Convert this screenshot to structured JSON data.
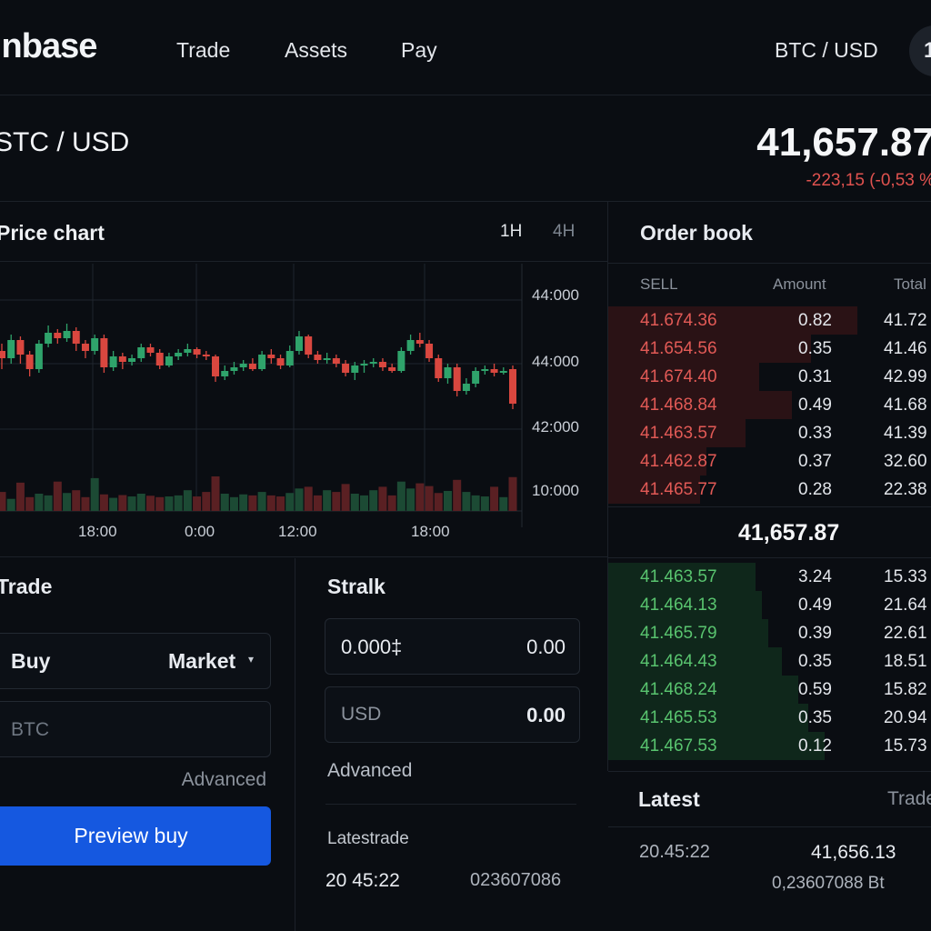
{
  "nav": {
    "logo": "inbase",
    "links": [
      "Trade",
      "Assets",
      "Pay"
    ],
    "pair": "BTC / USD",
    "avatar_initial": "1"
  },
  "ticker": {
    "pair": "STC / USD",
    "price": "41,657.87",
    "change": "-223,15 (-0,53 %"
  },
  "chart": {
    "title": "Price chart",
    "timeframes": [
      "1H",
      "4H"
    ],
    "y_labels": [
      "44:000",
      "44:000",
      "42:000",
      "10:000"
    ],
    "x_labels": [
      "18:00",
      "0:00",
      "12:00",
      "18:00"
    ]
  },
  "chart_data": {
    "type": "candlestick",
    "up_color": "#2fa36b",
    "down_color": "#d9473f",
    "note_candles": "open/close/high/low in price-axis units estimated from the printed tick labels",
    "candles": [
      {
        "o": 0.62,
        "c": 0.58,
        "h": 0.66,
        "l": 0.52
      },
      {
        "o": 0.58,
        "c": 0.68,
        "h": 0.71,
        "l": 0.55
      },
      {
        "o": 0.68,
        "c": 0.6,
        "h": 0.7,
        "l": 0.55
      },
      {
        "o": 0.6,
        "c": 0.52,
        "h": 0.62,
        "l": 0.48
      },
      {
        "o": 0.52,
        "c": 0.66,
        "h": 0.68,
        "l": 0.5
      },
      {
        "o": 0.66,
        "c": 0.72,
        "h": 0.76,
        "l": 0.64
      },
      {
        "o": 0.72,
        "c": 0.69,
        "h": 0.74,
        "l": 0.66
      },
      {
        "o": 0.69,
        "c": 0.73,
        "h": 0.77,
        "l": 0.67
      },
      {
        "o": 0.73,
        "c": 0.66,
        "h": 0.75,
        "l": 0.62
      },
      {
        "o": 0.66,
        "c": 0.62,
        "h": 0.68,
        "l": 0.58
      },
      {
        "o": 0.62,
        "c": 0.69,
        "h": 0.71,
        "l": 0.6
      },
      {
        "o": 0.69,
        "c": 0.53,
        "h": 0.71,
        "l": 0.5
      },
      {
        "o": 0.53,
        "c": 0.59,
        "h": 0.62,
        "l": 0.51
      },
      {
        "o": 0.59,
        "c": 0.56,
        "h": 0.61,
        "l": 0.52
      },
      {
        "o": 0.56,
        "c": 0.58,
        "h": 0.6,
        "l": 0.54
      },
      {
        "o": 0.58,
        "c": 0.64,
        "h": 0.66,
        "l": 0.56
      },
      {
        "o": 0.64,
        "c": 0.61,
        "h": 0.66,
        "l": 0.59
      },
      {
        "o": 0.61,
        "c": 0.54,
        "h": 0.63,
        "l": 0.52
      },
      {
        "o": 0.54,
        "c": 0.59,
        "h": 0.61,
        "l": 0.53
      },
      {
        "o": 0.59,
        "c": 0.61,
        "h": 0.63,
        "l": 0.57
      },
      {
        "o": 0.61,
        "c": 0.63,
        "h": 0.66,
        "l": 0.59
      },
      {
        "o": 0.63,
        "c": 0.6,
        "h": 0.64,
        "l": 0.58
      },
      {
        "o": 0.6,
        "c": 0.59,
        "h": 0.62,
        "l": 0.57
      },
      {
        "o": 0.59,
        "c": 0.48,
        "h": 0.6,
        "l": 0.45
      },
      {
        "o": 0.48,
        "c": 0.51,
        "h": 0.54,
        "l": 0.46
      },
      {
        "o": 0.51,
        "c": 0.53,
        "h": 0.56,
        "l": 0.49
      },
      {
        "o": 0.53,
        "c": 0.55,
        "h": 0.57,
        "l": 0.51
      },
      {
        "o": 0.55,
        "c": 0.52,
        "h": 0.58,
        "l": 0.51
      },
      {
        "o": 0.52,
        "c": 0.6,
        "h": 0.62,
        "l": 0.51
      },
      {
        "o": 0.6,
        "c": 0.58,
        "h": 0.63,
        "l": 0.55
      },
      {
        "o": 0.58,
        "c": 0.54,
        "h": 0.6,
        "l": 0.52
      },
      {
        "o": 0.54,
        "c": 0.62,
        "h": 0.65,
        "l": 0.53
      },
      {
        "o": 0.62,
        "c": 0.7,
        "h": 0.73,
        "l": 0.6
      },
      {
        "o": 0.7,
        "c": 0.6,
        "h": 0.71,
        "l": 0.58
      },
      {
        "o": 0.6,
        "c": 0.57,
        "h": 0.62,
        "l": 0.55
      },
      {
        "o": 0.57,
        "c": 0.58,
        "h": 0.61,
        "l": 0.55
      },
      {
        "o": 0.58,
        "c": 0.55,
        "h": 0.6,
        "l": 0.53
      },
      {
        "o": 0.55,
        "c": 0.5,
        "h": 0.57,
        "l": 0.48
      },
      {
        "o": 0.5,
        "c": 0.54,
        "h": 0.56,
        "l": 0.46
      },
      {
        "o": 0.54,
        "c": 0.55,
        "h": 0.57,
        "l": 0.5
      },
      {
        "o": 0.55,
        "c": 0.56,
        "h": 0.58,
        "l": 0.53
      },
      {
        "o": 0.56,
        "c": 0.53,
        "h": 0.58,
        "l": 0.51
      },
      {
        "o": 0.53,
        "c": 0.51,
        "h": 0.55,
        "l": 0.5
      },
      {
        "o": 0.51,
        "c": 0.62,
        "h": 0.64,
        "l": 0.5
      },
      {
        "o": 0.62,
        "c": 0.68,
        "h": 0.71,
        "l": 0.6
      },
      {
        "o": 0.68,
        "c": 0.66,
        "h": 0.72,
        "l": 0.64
      },
      {
        "o": 0.66,
        "c": 0.58,
        "h": 0.68,
        "l": 0.56
      },
      {
        "o": 0.58,
        "c": 0.47,
        "h": 0.6,
        "l": 0.45
      },
      {
        "o": 0.47,
        "c": 0.53,
        "h": 0.55,
        "l": 0.44
      },
      {
        "o": 0.53,
        "c": 0.4,
        "h": 0.55,
        "l": 0.37
      },
      {
        "o": 0.4,
        "c": 0.44,
        "h": 0.47,
        "l": 0.38
      },
      {
        "o": 0.44,
        "c": 0.51,
        "h": 0.53,
        "l": 0.42
      },
      {
        "o": 0.51,
        "c": 0.52,
        "h": 0.54,
        "l": 0.49
      },
      {
        "o": 0.52,
        "c": 0.5,
        "h": 0.55,
        "l": 0.48
      },
      {
        "o": 0.5,
        "c": 0.51,
        "h": 0.53,
        "l": 0.49
      },
      {
        "o": 0.52,
        "c": 0.33,
        "h": 0.54,
        "l": 0.3
      }
    ],
    "volumes": [
      0.55,
      0.35,
      0.82,
      0.4,
      0.5,
      0.45,
      0.85,
      0.52,
      0.6,
      0.4,
      0.95,
      0.48,
      0.38,
      0.46,
      0.42,
      0.5,
      0.44,
      0.4,
      0.42,
      0.45,
      0.6,
      0.42,
      0.55,
      1.0,
      0.5,
      0.4,
      0.48,
      0.45,
      0.55,
      0.45,
      0.42,
      0.52,
      0.65,
      0.7,
      0.45,
      0.6,
      0.55,
      0.78,
      0.5,
      0.45,
      0.6,
      0.7,
      0.45,
      0.85,
      0.65,
      0.8,
      0.72,
      0.52,
      0.58,
      0.9,
      0.55,
      0.45,
      0.42,
      0.7,
      0.4,
      0.98
    ]
  },
  "trade": {
    "title": "Trade",
    "side": "Buy",
    "order_type": "Market",
    "asset_placeholder": "BTC",
    "advanced": "Advanced",
    "preview_button": "Preview buy"
  },
  "stralk": {
    "title": "Stralk",
    "amount_value": "0.000‡",
    "amount_right": "0.00",
    "usd_label": "USD",
    "usd_value": "0.00",
    "advanced": "Advanced",
    "latest_trade_label": "Latestrade",
    "latest_time": "20 45:22",
    "latest_id": "023607086"
  },
  "orderbook": {
    "title": "Order book",
    "headers": [
      "SELL",
      "Amount",
      "Total"
    ],
    "mid_price": "41,657.87",
    "sells": [
      {
        "price": "41.674.36",
        "amount": "0.82",
        "total": "41.72",
        "depth": 0.76
      },
      {
        "price": "41.654.56",
        "amount": "0.35",
        "total": "41.46",
        "depth": 0.62
      },
      {
        "price": "41.674.40",
        "amount": "0.31",
        "total": "42.99",
        "depth": 0.46
      },
      {
        "price": "41.468.84",
        "amount": "0.49",
        "total": "41.68",
        "depth": 0.56
      },
      {
        "price": "41.463.57",
        "amount": "0.33",
        "total": "41.39",
        "depth": 0.42
      },
      {
        "price": "41.462.87",
        "amount": "0.37",
        "total": "32.60",
        "depth": 0.3
      },
      {
        "price": "41.465.77",
        "amount": "0.28",
        "total": "22.38",
        "depth": 0.28
      }
    ],
    "buys": [
      {
        "price": "41.463.57",
        "amount": "3.24",
        "total": "15.33",
        "depth": 0.45
      },
      {
        "price": "41.464.13",
        "amount": "0.49",
        "total": "21.64",
        "depth": 0.47
      },
      {
        "price": "41.465.79",
        "amount": "0.39",
        "total": "22.61",
        "depth": 0.49
      },
      {
        "price": "41.464.43",
        "amount": "0.35",
        "total": "18.51",
        "depth": 0.53
      },
      {
        "price": "41.468.24",
        "amount": "0.59",
        "total": "15.82",
        "depth": 0.58
      },
      {
        "price": "41.465.53",
        "amount": "0.35",
        "total": "20.94",
        "depth": 0.61
      },
      {
        "price": "41.467.53",
        "amount": "0.12",
        "total": "15.73",
        "depth": 0.66
      }
    ]
  },
  "latest": {
    "title": "Latest",
    "tab": "Trades",
    "time": "20.45:22",
    "price": "41,656.13",
    "amount": "0,23607088 Bt"
  },
  "colors": {
    "background": "#0a0d12",
    "sell_red": "#e25a56",
    "buy_green": "#59c46f",
    "primary_blue": "#1558e0"
  }
}
